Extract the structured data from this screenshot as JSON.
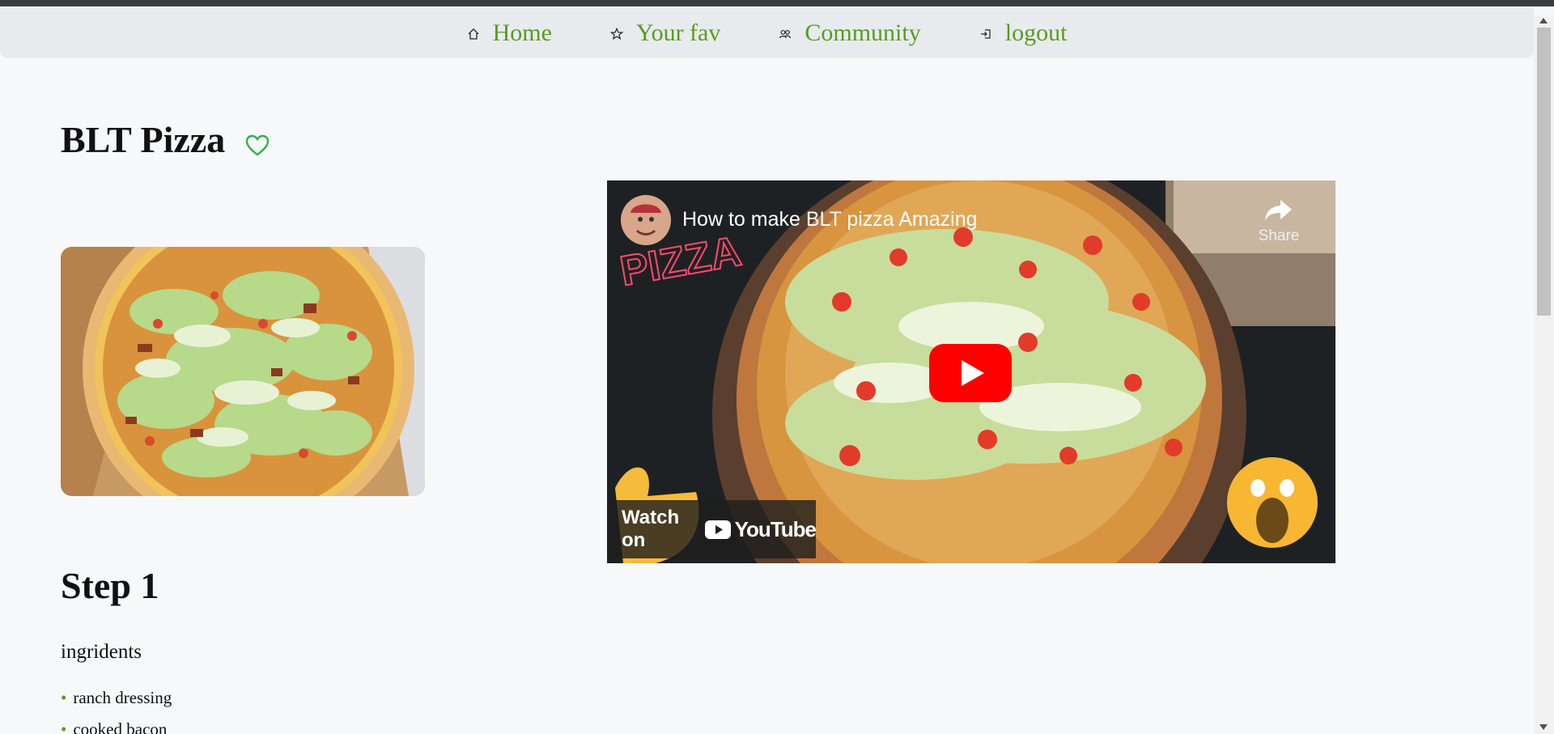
{
  "nav": {
    "items": [
      {
        "label": "Home",
        "icon": "home-icon"
      },
      {
        "label": "Your fav",
        "icon": "star-icon"
      },
      {
        "label": "Community",
        "icon": "people-icon"
      },
      {
        "label": "logout",
        "icon": "logout-icon"
      }
    ]
  },
  "recipe": {
    "title": "BLT Pizza",
    "favorite_icon": "heart-outline-icon",
    "accent_color": "#5a9a22",
    "heart_color": "#2fb34a"
  },
  "video": {
    "title": "How to make BLT pizza Amazing",
    "share_label": "Share",
    "watch_on_label": "Watch on",
    "youtube_label": "YouTube"
  },
  "step": {
    "title": "Step 1",
    "ingredients_title": "ingridents",
    "ingredients": [
      "ranch dressing",
      "cooked bacon"
    ]
  }
}
